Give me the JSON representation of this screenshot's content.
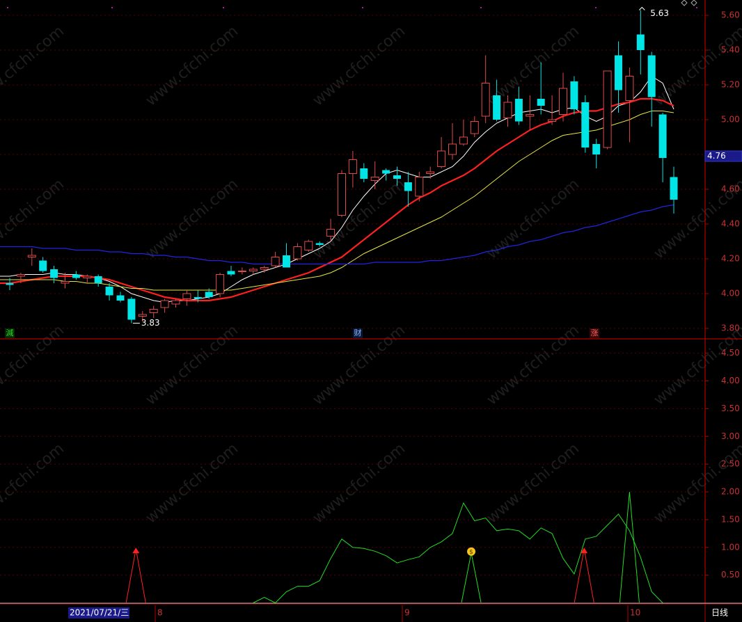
{
  "colors": {
    "background": "#000000",
    "grid": "#5a0000",
    "frame": "#b00000",
    "axis_text": "#c83232",
    "up": "#e04a4a",
    "down": "#00e5e5",
    "ma_white": "#ffffff",
    "ma_red": "#ff2020",
    "ma_yellow": "#e6e640",
    "ma_blue": "#2323e0",
    "osc_green": "#22dd22",
    "signal_red": "#ff2020",
    "watermark": "#1e1e1e"
  },
  "watermark": "www.cfchi.com",
  "current_price_tag": "4.76",
  "date_bar": {
    "cursor_date": "2021/07/21/三",
    "months": [
      "8",
      "9",
      "10"
    ],
    "period": "日线"
  },
  "markers": {
    "high_label": "5.63",
    "low_label": "3.83",
    "news_left": "減",
    "news_mid": "财",
    "news_right": "涨",
    "money_icon": "money-bag-icon"
  },
  "chart_data": [
    {
      "type": "candlestick",
      "title": "",
      "y_ticks": [
        "5.60",
        "5.40",
        "5.20",
        "5.00",
        "4.80",
        "4.60",
        "4.40",
        "4.20",
        "4.00",
        "3.80"
      ],
      "ylim": [
        3.8,
        5.64
      ],
      "grid": true,
      "candles": [
        {
          "o": 4.06,
          "h": 4.09,
          "l": 4.02,
          "c": 4.05
        },
        {
          "o": 4.1,
          "h": 4.12,
          "l": 4.06,
          "c": 4.11
        },
        {
          "o": 4.21,
          "h": 4.26,
          "l": 4.16,
          "c": 4.22
        },
        {
          "o": 4.19,
          "h": 4.21,
          "l": 4.12,
          "c": 4.13
        },
        {
          "o": 4.14,
          "h": 4.16,
          "l": 4.06,
          "c": 4.09
        },
        {
          "o": 4.06,
          "h": 4.12,
          "l": 4.03,
          "c": 4.07
        },
        {
          "o": 4.11,
          "h": 4.13,
          "l": 4.08,
          "c": 4.09
        },
        {
          "o": 4.09,
          "h": 4.11,
          "l": 4.06,
          "c": 4.1
        },
        {
          "o": 4.1,
          "h": 4.11,
          "l": 4.04,
          "c": 4.06
        },
        {
          "o": 4.04,
          "h": 4.06,
          "l": 3.96,
          "c": 3.99
        },
        {
          "o": 3.99,
          "h": 4.01,
          "l": 3.95,
          "c": 3.96
        },
        {
          "o": 3.97,
          "h": 3.98,
          "l": 3.83,
          "c": 3.85
        },
        {
          "o": 3.87,
          "h": 3.9,
          "l": 3.84,
          "c": 3.88
        },
        {
          "o": 3.89,
          "h": 3.93,
          "l": 3.86,
          "c": 3.91
        },
        {
          "o": 3.92,
          "h": 3.97,
          "l": 3.89,
          "c": 3.96
        },
        {
          "o": 3.94,
          "h": 3.97,
          "l": 3.92,
          "c": 3.96
        },
        {
          "o": 3.97,
          "h": 4.02,
          "l": 3.93,
          "c": 4.0
        },
        {
          "o": 3.98,
          "h": 4.02,
          "l": 3.95,
          "c": 3.97
        },
        {
          "o": 4.01,
          "h": 4.03,
          "l": 3.97,
          "c": 3.98
        },
        {
          "o": 4.0,
          "h": 4.12,
          "l": 3.98,
          "c": 4.11
        },
        {
          "o": 4.13,
          "h": 4.16,
          "l": 4.1,
          "c": 4.11
        },
        {
          "o": 4.13,
          "h": 4.15,
          "l": 4.11,
          "c": 4.13
        },
        {
          "o": 4.13,
          "h": 4.15,
          "l": 4.11,
          "c": 4.14
        },
        {
          "o": 4.14,
          "h": 4.16,
          "l": 4.12,
          "c": 4.15
        },
        {
          "o": 4.16,
          "h": 4.24,
          "l": 4.15,
          "c": 4.21
        },
        {
          "o": 4.22,
          "h": 4.29,
          "l": 4.15,
          "c": 4.15
        },
        {
          "o": 4.2,
          "h": 4.29,
          "l": 4.19,
          "c": 4.27
        },
        {
          "o": 4.25,
          "h": 4.31,
          "l": 4.24,
          "c": 4.3
        },
        {
          "o": 4.29,
          "h": 4.3,
          "l": 4.27,
          "c": 4.28
        },
        {
          "o": 4.33,
          "h": 4.43,
          "l": 4.3,
          "c": 4.37
        },
        {
          "o": 4.45,
          "h": 4.71,
          "l": 4.44,
          "c": 4.69
        },
        {
          "o": 4.69,
          "h": 4.82,
          "l": 4.61,
          "c": 4.77
        },
        {
          "o": 4.72,
          "h": 4.75,
          "l": 4.64,
          "c": 4.66
        },
        {
          "o": 4.65,
          "h": 4.76,
          "l": 4.6,
          "c": 4.67
        },
        {
          "o": 4.71,
          "h": 4.72,
          "l": 4.65,
          "c": 4.69
        },
        {
          "o": 4.68,
          "h": 4.73,
          "l": 4.62,
          "c": 4.66
        },
        {
          "o": 4.64,
          "h": 4.7,
          "l": 4.5,
          "c": 4.59
        },
        {
          "o": 4.56,
          "h": 4.7,
          "l": 4.53,
          "c": 4.67
        },
        {
          "o": 4.69,
          "h": 4.73,
          "l": 4.66,
          "c": 4.7
        },
        {
          "o": 4.73,
          "h": 4.9,
          "l": 4.72,
          "c": 4.82
        },
        {
          "o": 4.8,
          "h": 4.98,
          "l": 4.77,
          "c": 4.86
        },
        {
          "o": 4.86,
          "h": 5.0,
          "l": 4.85,
          "c": 4.9
        },
        {
          "o": 4.92,
          "h": 5.02,
          "l": 4.9,
          "c": 4.99
        },
        {
          "o": 5.02,
          "h": 5.37,
          "l": 4.98,
          "c": 5.21
        },
        {
          "o": 5.14,
          "h": 5.23,
          "l": 4.99,
          "c": 5.0
        },
        {
          "o": 5.01,
          "h": 5.14,
          "l": 4.96,
          "c": 5.1
        },
        {
          "o": 5.12,
          "h": 5.19,
          "l": 4.97,
          "c": 4.99
        },
        {
          "o": 5.02,
          "h": 5.14,
          "l": 4.94,
          "c": 5.03
        },
        {
          "o": 5.12,
          "h": 5.33,
          "l": 5.03,
          "c": 5.08
        },
        {
          "o": 4.99,
          "h": 5.14,
          "l": 4.97,
          "c": 5.0
        },
        {
          "o": 5.03,
          "h": 5.27,
          "l": 4.99,
          "c": 5.18
        },
        {
          "o": 5.22,
          "h": 5.25,
          "l": 5.03,
          "c": 5.06
        },
        {
          "o": 5.1,
          "h": 5.14,
          "l": 4.81,
          "c": 4.84
        },
        {
          "o": 4.86,
          "h": 4.89,
          "l": 4.72,
          "c": 4.8
        },
        {
          "o": 4.84,
          "h": 5.28,
          "l": 4.83,
          "c": 5.28
        },
        {
          "o": 5.37,
          "h": 5.45,
          "l": 5.04,
          "c": 5.17
        },
        {
          "o": 5.11,
          "h": 5.3,
          "l": 4.87,
          "c": 5.25
        },
        {
          "o": 5.49,
          "h": 5.63,
          "l": 5.26,
          "c": 5.4
        },
        {
          "o": 5.37,
          "h": 5.39,
          "l": 4.96,
          "c": 5.13
        },
        {
          "o": 5.03,
          "h": 5.04,
          "l": 4.64,
          "c": 4.78
        },
        {
          "o": 4.67,
          "h": 4.73,
          "l": 4.46,
          "c": 4.54
        }
      ],
      "series": [
        {
          "name": "",
          "color_key": "ma_white",
          "values": [
            4.1,
            4.11,
            4.11,
            4.11,
            4.12,
            4.11,
            4.11,
            4.1,
            4.09,
            4.07,
            4.04,
            4.0,
            3.98,
            3.96,
            3.95,
            3.96,
            3.96,
            3.97,
            3.98,
            4.0,
            4.04,
            4.08,
            4.11,
            4.13,
            4.15,
            4.17,
            4.2,
            4.23,
            4.26,
            4.3,
            4.38,
            4.48,
            4.56,
            4.63,
            4.69,
            4.71,
            4.69,
            4.67,
            4.67,
            4.7,
            4.73,
            4.79,
            4.87,
            4.93,
            4.98,
            5.01,
            5.04,
            5.05,
            5.06,
            5.04,
            5.06,
            5.07,
            5.02,
            4.99,
            5.02,
            5.08,
            5.1,
            5.16,
            5.25,
            5.21,
            5.06
          ]
        },
        {
          "name": "",
          "color_key": "ma_red",
          "values": [
            4.06,
            4.07,
            4.08,
            4.09,
            4.1,
            4.1,
            4.1,
            4.1,
            4.09,
            4.08,
            4.06,
            4.04,
            4.02,
            4.0,
            3.98,
            3.97,
            3.96,
            3.96,
            3.96,
            3.97,
            3.98,
            4.0,
            4.02,
            4.04,
            4.06,
            4.08,
            4.1,
            4.12,
            4.15,
            4.18,
            4.21,
            4.26,
            4.31,
            4.36,
            4.41,
            4.46,
            4.51,
            4.55,
            4.58,
            4.62,
            4.65,
            4.68,
            4.72,
            4.77,
            4.82,
            4.86,
            4.9,
            4.94,
            4.97,
            4.99,
            5.02,
            5.04,
            5.05,
            5.05,
            5.07,
            5.09,
            5.1,
            5.12,
            5.12,
            5.11,
            5.08
          ]
        },
        {
          "name": "",
          "color_key": "ma_yellow",
          "values": [
            4.08,
            4.08,
            4.08,
            4.08,
            4.08,
            4.07,
            4.07,
            4.06,
            4.06,
            4.05,
            4.04,
            4.03,
            4.03,
            4.02,
            4.02,
            4.02,
            4.02,
            4.02,
            4.02,
            4.02,
            4.02,
            4.03,
            4.04,
            4.05,
            4.06,
            4.07,
            4.08,
            4.09,
            4.1,
            4.12,
            4.15,
            4.19,
            4.23,
            4.26,
            4.29,
            4.32,
            4.35,
            4.38,
            4.41,
            4.44,
            4.48,
            4.52,
            4.56,
            4.61,
            4.66,
            4.71,
            4.76,
            4.8,
            4.84,
            4.88,
            4.91,
            4.92,
            4.93,
            4.94,
            4.96,
            4.98,
            5.0,
            5.03,
            5.05,
            5.05,
            5.04
          ]
        },
        {
          "name": "",
          "color_key": "ma_blue",
          "values": [
            4.27,
            4.27,
            4.27,
            4.26,
            4.26,
            4.26,
            4.25,
            4.25,
            4.25,
            4.24,
            4.24,
            4.23,
            4.23,
            4.22,
            4.22,
            4.21,
            4.21,
            4.2,
            4.19,
            4.19,
            4.18,
            4.18,
            4.17,
            4.17,
            4.17,
            4.17,
            4.17,
            4.17,
            4.17,
            4.17,
            4.17,
            4.17,
            4.17,
            4.18,
            4.18,
            4.18,
            4.18,
            4.18,
            4.19,
            4.19,
            4.2,
            4.21,
            4.22,
            4.24,
            4.25,
            4.27,
            4.28,
            4.3,
            4.31,
            4.33,
            4.35,
            4.36,
            4.38,
            4.39,
            4.41,
            4.43,
            4.45,
            4.47,
            4.48,
            4.5,
            4.51
          ]
        }
      ]
    },
    {
      "type": "line",
      "title": "",
      "y_ticks": [
        "4.50",
        "4.00",
        "3.50",
        "3.00",
        "2.50",
        "2.00",
        "1.50",
        "1.00",
        "0.50"
      ],
      "ylim": [
        0.0,
        4.75
      ],
      "grid": true,
      "series": [
        {
          "name": "",
          "color_key": "osc_green",
          "values": [
            null,
            null,
            null,
            null,
            null,
            null,
            null,
            null,
            null,
            null,
            null,
            null,
            null,
            null,
            null,
            null,
            null,
            null,
            null,
            null,
            null,
            null,
            0.0,
            0.1,
            0.0,
            0.2,
            0.3,
            0.3,
            0.4,
            0.8,
            1.15,
            1.0,
            0.98,
            0.93,
            0.85,
            0.72,
            0.78,
            0.83,
            1.0,
            1.1,
            1.25,
            1.8,
            1.48,
            1.53,
            1.3,
            1.33,
            1.3,
            1.15,
            1.35,
            1.25,
            0.8,
            0.52,
            1.15,
            1.2,
            1.4,
            1.6,
            1.3,
            0.82,
            0.2,
            0.0
          ]
        }
      ],
      "peaks": [
        {
          "x": 11.4,
          "height": 0.97,
          "color_key": "signal_red"
        },
        {
          "x": 41.7,
          "height": 0.9,
          "color_key": "osc_green"
        },
        {
          "x": 51.9,
          "height": 0.97,
          "color_key": "signal_red"
        },
        {
          "x": 56.0,
          "height": 2.0,
          "color_key": "osc_green"
        }
      ]
    }
  ]
}
